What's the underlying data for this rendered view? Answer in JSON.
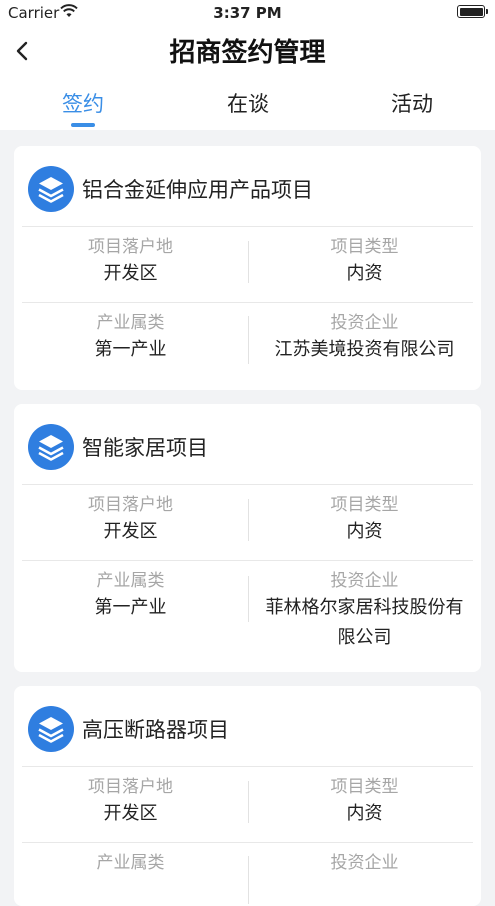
{
  "status_bar": {
    "carrier": "Carrier",
    "time": "3:37 PM"
  },
  "nav": {
    "title": "招商签约管理"
  },
  "tabs": [
    {
      "label": "签约",
      "active": true
    },
    {
      "label": "在谈",
      "active": false
    },
    {
      "label": "活动",
      "active": false
    }
  ],
  "field_labels": {
    "location": "项目落户地",
    "type": "项目类型",
    "industry": "产业属类",
    "company": "投资企业"
  },
  "projects": [
    {
      "name": "铝合金延伸应用产品项目",
      "location": "开发区",
      "type": "内资",
      "industry": "第一产业",
      "company_lines": [
        "江苏美境投资有限公司"
      ]
    },
    {
      "name": "智能家居项目",
      "location": "开发区",
      "type": "内资",
      "industry": "第一产业",
      "company_lines": [
        "菲林格尔家居科技股份有",
        "限公司"
      ]
    },
    {
      "name": "高压断路器项目",
      "location": "开发区",
      "type": "内资",
      "industry": "",
      "company_lines": [
        ""
      ]
    }
  ],
  "colors": {
    "accent": "#3a8ee6",
    "icon": "#2f7ee0",
    "background": "#f2f3f5"
  }
}
